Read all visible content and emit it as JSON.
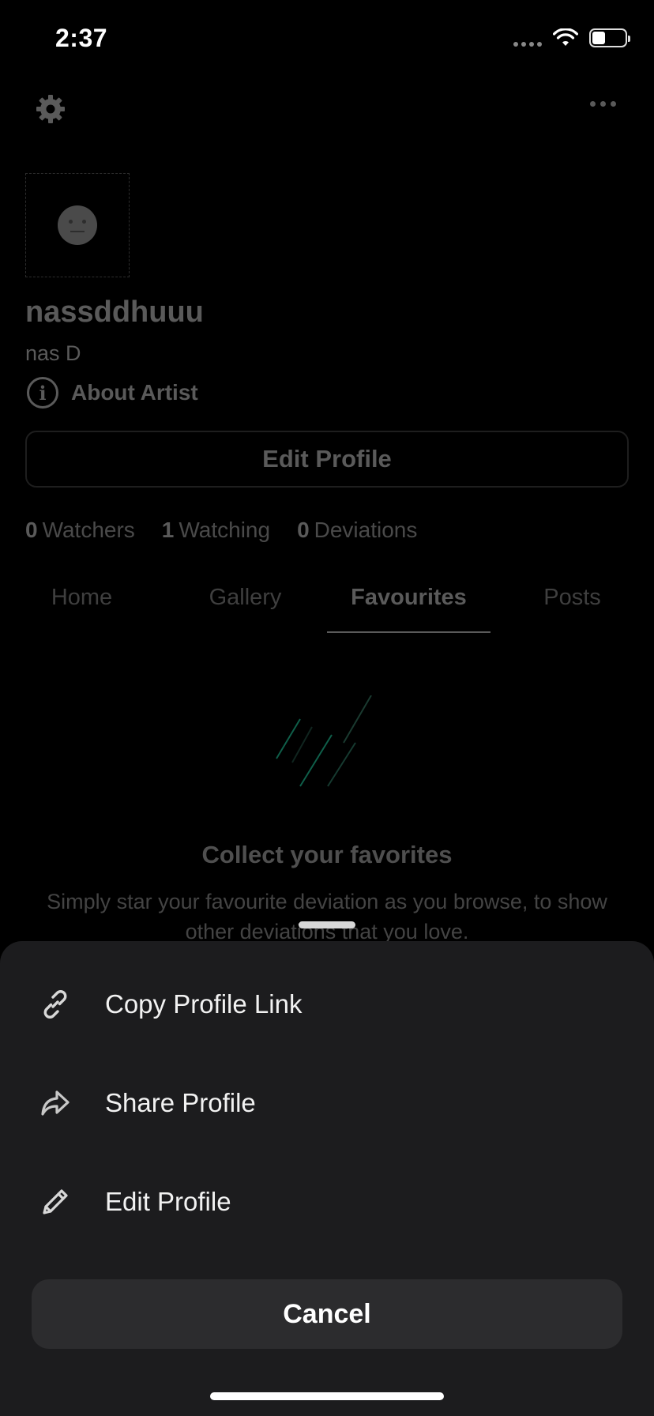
{
  "status_bar": {
    "time": "2:37",
    "battery_percent": 40
  },
  "profile": {
    "username": "nassddhuuu",
    "display_name": "nas D",
    "about_label": "About Artist",
    "edit_profile_label": "Edit Profile",
    "stats": [
      {
        "count": "0",
        "label": "Watchers"
      },
      {
        "count": "1",
        "label": "Watching"
      },
      {
        "count": "0",
        "label": "Deviations"
      }
    ]
  },
  "tabs": [
    {
      "label": "Home",
      "active": false
    },
    {
      "label": "Gallery",
      "active": false
    },
    {
      "label": "Favourites",
      "active": true
    },
    {
      "label": "Posts",
      "active": false
    }
  ],
  "empty_state": {
    "title": "Collect your favorites",
    "description": "Simply star your favourite deviation as you browse, to show other deviations that you love."
  },
  "sheet": {
    "items": [
      {
        "label": "Copy Profile Link",
        "icon": "link-icon"
      },
      {
        "label": "Share Profile",
        "icon": "share-icon"
      },
      {
        "label": "Edit Profile",
        "icon": "pencil-icon"
      }
    ],
    "cancel_label": "Cancel"
  },
  "colors": {
    "sheet_bg": "#1c1c1e",
    "cancel_bg": "#2c2c2e",
    "accent_green": "#0f5f4a"
  }
}
